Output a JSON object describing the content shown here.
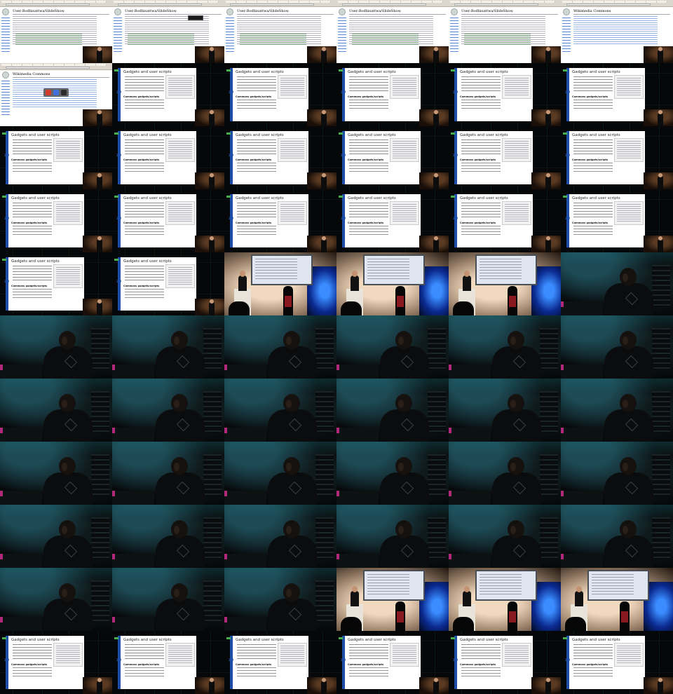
{
  "grid": {
    "columns": 6,
    "rows": 11
  },
  "wiki": {
    "page_title": "User:Bodhisattwa/SlideShow",
    "page_title_alt": "Wikimedia Commons",
    "menu_label": ""
  },
  "slide": {
    "title": "Gadgets and user scripts",
    "subheading": "Commons gadgets/scripts",
    "watermark": "2W"
  },
  "colors": {
    "slide_accent": "#1f4ea8",
    "wiki_link": "#3366cc",
    "stage_blue": "#3a8cff",
    "slide_green": "#46b04a"
  },
  "tiles": [
    "wiki",
    "wiki-menu",
    "wiki",
    "wiki",
    "wiki",
    "wiki-contrib",
    "wiki-dock",
    "slide",
    "slide",
    "slide",
    "slide",
    "slide",
    "slide",
    "slide",
    "slide",
    "slide",
    "slide",
    "slide",
    "slide",
    "slide",
    "slide",
    "slide",
    "slide",
    "slide",
    "slide",
    "slide",
    "stage",
    "stage",
    "stage",
    "coder",
    "coder",
    "coder",
    "coder",
    "coder",
    "coder",
    "coder",
    "coder",
    "coder",
    "coder",
    "coder",
    "coder",
    "coder",
    "coder",
    "coder",
    "coder",
    "coder",
    "coder",
    "coder",
    "coder",
    "coder",
    "coder",
    "coder",
    "coder",
    "coder",
    "coder",
    "coder",
    "coder",
    "stage",
    "stage",
    "stage",
    "slide",
    "slide",
    "slide",
    "slide",
    "slide",
    "slide"
  ]
}
